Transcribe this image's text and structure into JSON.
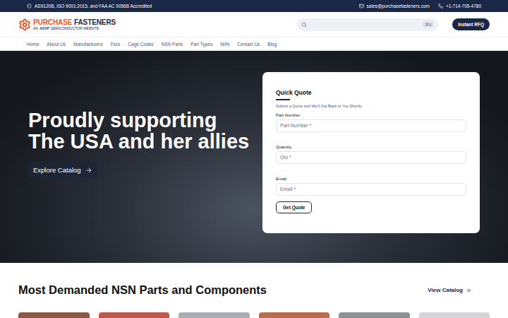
{
  "top_bar": {
    "accreditation": "AS9120B, ISO 9001:2015, and FAA AC 0056B Accredited",
    "email": "sales@purchasefasteners.com",
    "phone": "+1-714-705-4780"
  },
  "logo": {
    "word1": "PURCHASE",
    "word2": "FASTENERS",
    "sub_prefix": "AN",
    "sub_brand": "ASAP",
    "sub_suffix": "SEMICONDUCTOR WEBSITE"
  },
  "search": {
    "shortcut": "⌘K"
  },
  "rfq_button": "Instant RFQ",
  "nav": [
    {
      "label": "Home",
      "selected": false
    },
    {
      "label": "About Us",
      "selected": false
    },
    {
      "label": "Manufacturers",
      "selected": false
    },
    {
      "label": "Fscs",
      "selected": false
    },
    {
      "label": "Cage Codes",
      "selected": false
    },
    {
      "label": "NSN Parts",
      "selected": false
    },
    {
      "label": "Part Types",
      "selected": false
    },
    {
      "label": "NIIN",
      "selected": false
    },
    {
      "label": "Contact Us",
      "selected": false
    },
    {
      "label": "Blog",
      "selected": false
    }
  ],
  "hero": {
    "heading": "Proudly supporting The USA and her allies",
    "button": "Explore Catalog"
  },
  "quick_quote": {
    "title": "Quick Quote",
    "subtitle": "Submit a Quote and We'll Get Back to You Shortly",
    "fields": [
      {
        "label": "Part Number",
        "placeholder": "Part Number *"
      },
      {
        "label": "Quantity",
        "placeholder": "Qty *"
      },
      {
        "label": "Email",
        "placeholder": "Email *"
      }
    ],
    "button": "Get Quote"
  },
  "section": {
    "title": "Most Demanded NSN Parts and Components",
    "link": "View Catalog"
  },
  "product_cards": [
    {
      "color": "#8a5a44"
    },
    {
      "color": "#c0584a"
    },
    {
      "color": "#a9aeb5"
    },
    {
      "color": "#b86e4e"
    },
    {
      "color": "#8e9297"
    },
    {
      "color": "#d4d6d9"
    }
  ]
}
